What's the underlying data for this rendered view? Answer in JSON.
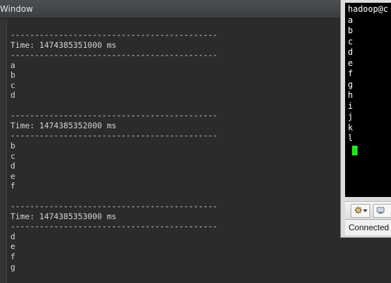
{
  "menu": {
    "window_label": "Window"
  },
  "console": {
    "lines": [
      "-------------------------------------------",
      "Time: 1474385351000 ms",
      "-------------------------------------------",
      "a",
      "b",
      "c",
      "d",
      "",
      "-------------------------------------------",
      "Time: 1474385352000 ms",
      "-------------------------------------------",
      "b",
      "c",
      "d",
      "e",
      "f",
      "",
      "-------------------------------------------",
      "Time: 1474385353000 ms",
      "-------------------------------------------",
      "d",
      "e",
      "f",
      "g"
    ]
  },
  "terminal": {
    "lines": [
      "hadoop@c",
      "a",
      "b",
      "c",
      "d",
      "e",
      "f",
      "g",
      "h",
      "i",
      "j",
      "k",
      "l"
    ],
    "cursor_color": "#1ee81e",
    "status_text": "Connected to"
  },
  "icons": {
    "toolbar_1": "settings-gear-icon",
    "toolbar_2": "session-icon"
  }
}
